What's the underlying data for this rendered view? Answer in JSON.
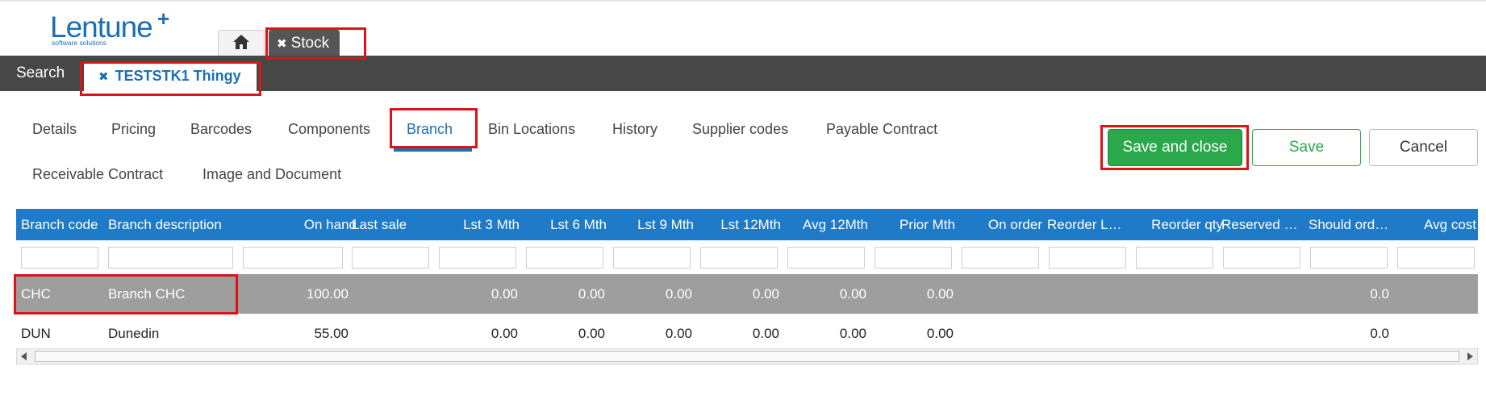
{
  "logo": {
    "word": "Lentune",
    "plus": "+",
    "sub": "software solutions"
  },
  "module_tabs": {
    "home_icon": "home-icon",
    "stock_close": "✖",
    "stock_label": "Stock"
  },
  "navbar": {
    "search_label": "Search",
    "record_close": "✖",
    "record_label": "TESTSTK1 Thingy"
  },
  "section_tabs": [
    {
      "label": "Details"
    },
    {
      "label": "Pricing"
    },
    {
      "label": "Barcodes"
    },
    {
      "label": "Components"
    },
    {
      "label": "Branch",
      "active": true
    },
    {
      "label": "Bin Locations"
    },
    {
      "label": "History"
    },
    {
      "label": "Supplier codes"
    },
    {
      "label": "Payable Contract"
    },
    {
      "label": "Receivable Contract"
    },
    {
      "label": "Image and Document"
    }
  ],
  "buttons": {
    "save_close": "Save and close",
    "save": "Save",
    "cancel": "Cancel"
  },
  "grid": {
    "columns": [
      "Branch code",
      "Branch description",
      "On hand",
      "Last sale",
      "Lst 3 Mth",
      "Lst 6 Mth",
      "Lst 9 Mth",
      "Lst 12Mth",
      "Avg 12Mth",
      "Prior Mth",
      "On order",
      "Reorder L…",
      "Reorder qty",
      "Reserved …",
      "Should ord…",
      "Avg cost"
    ],
    "rows": [
      {
        "code": "CHC",
        "description": "Branch CHC",
        "on_hand": "100.00",
        "last_sale": "",
        "lst3": "0.00",
        "lst6": "0.00",
        "lst9": "0.00",
        "lst12": "0.00",
        "avg12": "0.00",
        "prior": "0.00",
        "should_order": "0.0",
        "selected": true
      },
      {
        "code": "DUN",
        "description": "Dunedin",
        "on_hand": "55.00",
        "last_sale": "",
        "lst3": "0.00",
        "lst6": "0.00",
        "lst9": "0.00",
        "lst12": "0.00",
        "avg12": "0.00",
        "prior": "0.00",
        "should_order": "0.0",
        "selected": false
      }
    ]
  },
  "colors": {
    "brand": "#1a6fb5",
    "header": "#1f7ac7",
    "primary": "#2aa84a",
    "nav": "#474747",
    "highlight": "#d9141a"
  }
}
